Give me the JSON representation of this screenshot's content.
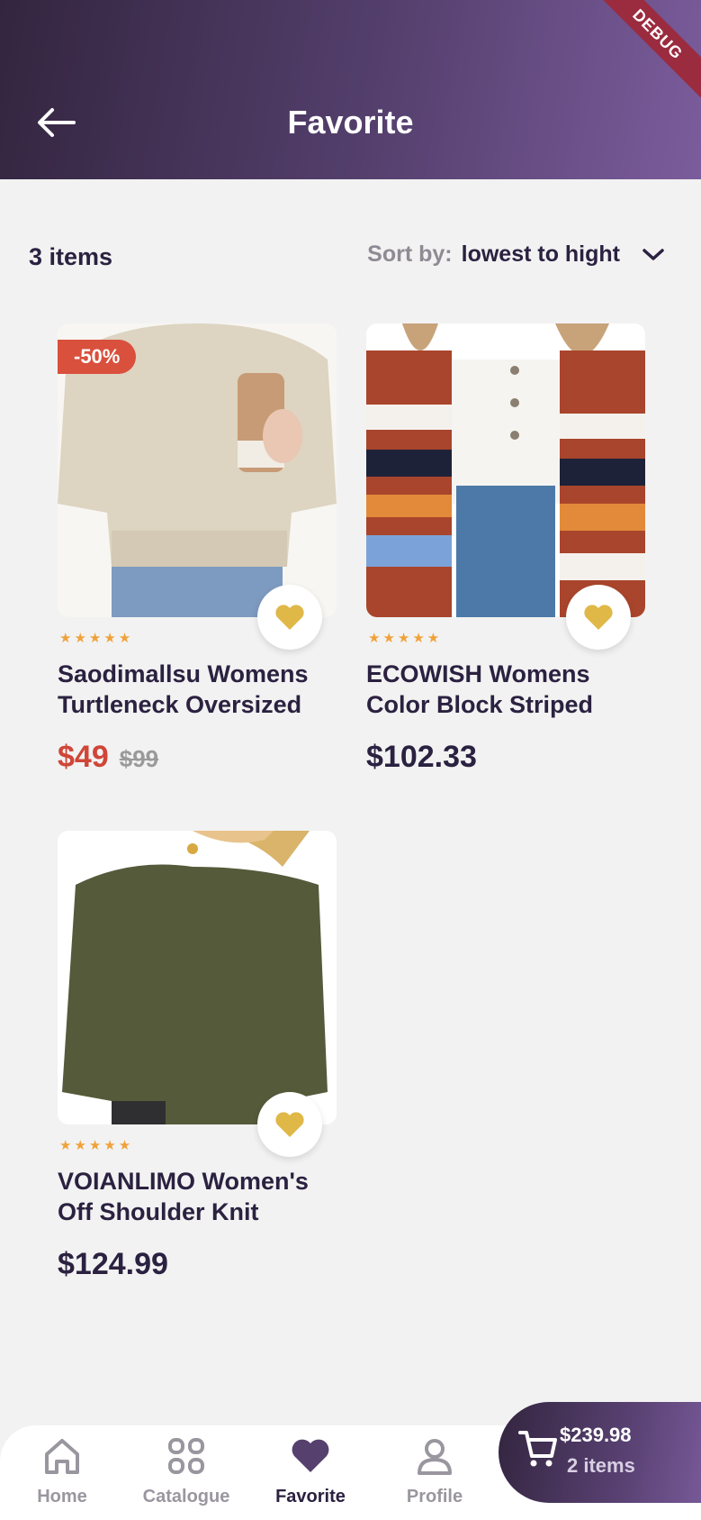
{
  "header": {
    "title": "Favorite",
    "debug": "DEBUG"
  },
  "toolbar": {
    "count": "3 items",
    "sort_label": "Sort by:",
    "sort_value": "lowest to hight"
  },
  "products": [
    {
      "badge": "-50%",
      "rating": 5,
      "title_line1": "Saodimallsu Womens",
      "title_line2": "Turtleneck Oversized",
      "price": "$49",
      "old_price": "$99",
      "favorite": true
    },
    {
      "rating": 5,
      "title_line1": "ECOWISH Womens",
      "title_line2": "Color Block Striped",
      "price": "$102.33",
      "favorite": true
    },
    {
      "rating": 5,
      "title_line1": "VOIANLIMO Women's",
      "title_line2": "Off Shoulder Knit",
      "price": "$124.99",
      "favorite": true
    }
  ],
  "nav": [
    {
      "label": "Home",
      "icon": "home-icon"
    },
    {
      "label": "Catalogue",
      "icon": "grid-icon"
    },
    {
      "label": "Favorite",
      "icon": "heart-icon",
      "active": true
    },
    {
      "label": "Profile",
      "icon": "user-icon"
    }
  ],
  "cart": {
    "total": "$239.98",
    "count": "2 items"
  },
  "colors": {
    "accent": "#55406e",
    "sale": "#cf4638",
    "heart": "#e0b848",
    "star": "#f0a23a"
  }
}
